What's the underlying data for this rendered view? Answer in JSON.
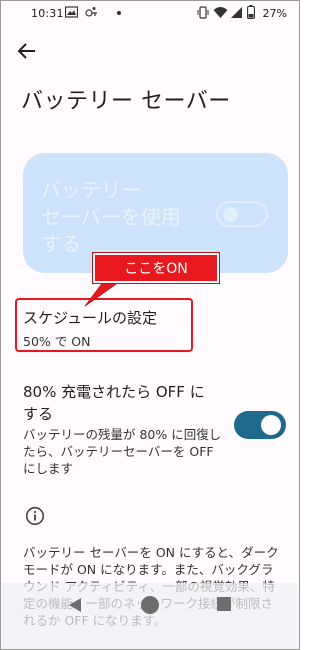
{
  "status_bar": {
    "time": "10:31",
    "battery_percent": "27%",
    "icons": [
      "gallery-icon",
      "vpn-icon",
      "notification-dot",
      "vibrate-icon",
      "wifi-icon",
      "signal-icon",
      "battery-icon"
    ]
  },
  "header": {
    "title": "バッテリー セーバー"
  },
  "main_toggle": {
    "label": "バッテリー\nセーバーを使用\nする",
    "state": "off",
    "enabled": false
  },
  "callout": {
    "text": "ここをON",
    "color": "#e8191e"
  },
  "schedule": {
    "title": "スケジュールの設定",
    "subtitle": "50% で ON"
  },
  "charge_off": {
    "title": "80% 充電されたら OFF に\nする",
    "description": "バッテリーの残量が 80% に回復したら、バッテリーセーバーを OFF にします",
    "state": "on",
    "accent": "#1f6a8c"
  },
  "info": {
    "icon": "info-icon",
    "text": "バッテリー セーバーを ON にすると、ダークモードが ON になります。また、バックグラウンド アクティビティ、一部の視覚効果、特定の機能、一部のネットワーク接続が制限されるか OFF になります。"
  },
  "nav_bar": {
    "buttons": [
      "back",
      "home",
      "recents"
    ]
  }
}
